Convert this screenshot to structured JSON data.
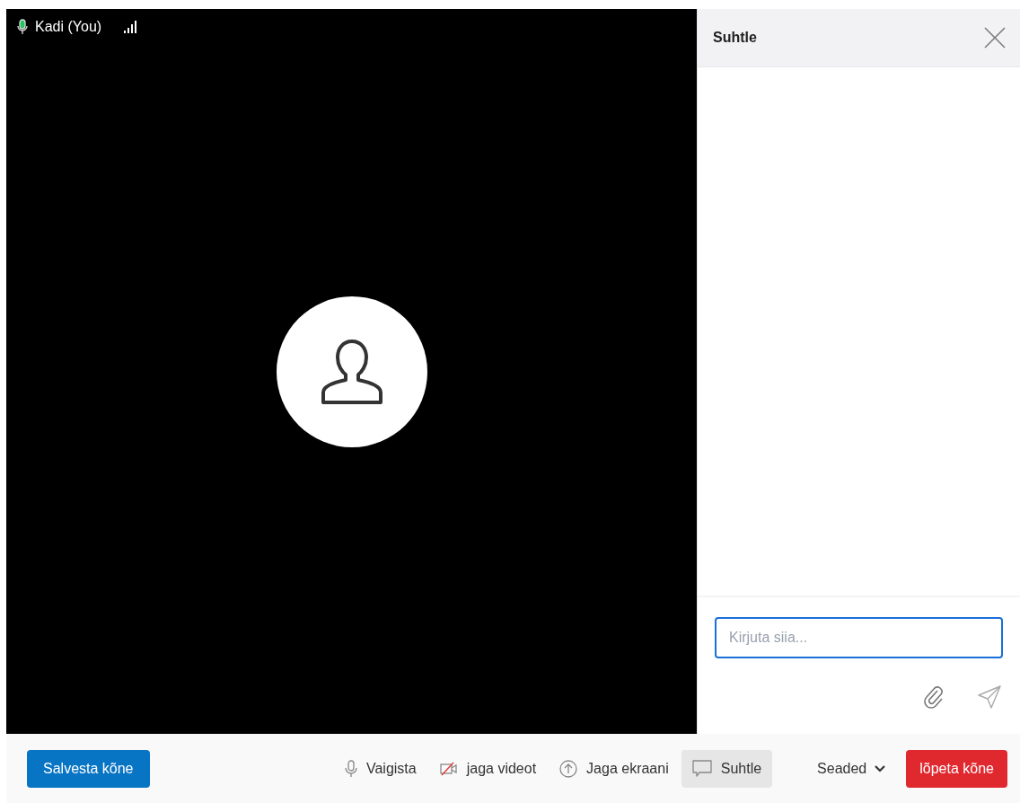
{
  "participant": {
    "name": "Kadi (You)",
    "mic_active": true
  },
  "chat": {
    "title": "Suhtle",
    "input": {
      "placeholder": "Kirjuta siia..."
    }
  },
  "toolbar": {
    "record_button": "Salvesta kõne",
    "controls": [
      {
        "kind": "mic",
        "label": "Vaigista",
        "selected": false
      },
      {
        "kind": "video",
        "label": "jaga videot",
        "selected": false
      },
      {
        "kind": "screen",
        "label": "Jaga ekraani",
        "selected": false
      },
      {
        "kind": "chat",
        "label": "Suhtle",
        "selected": true
      }
    ],
    "settings": "Seaded",
    "end_button": "lõpeta kõne"
  }
}
